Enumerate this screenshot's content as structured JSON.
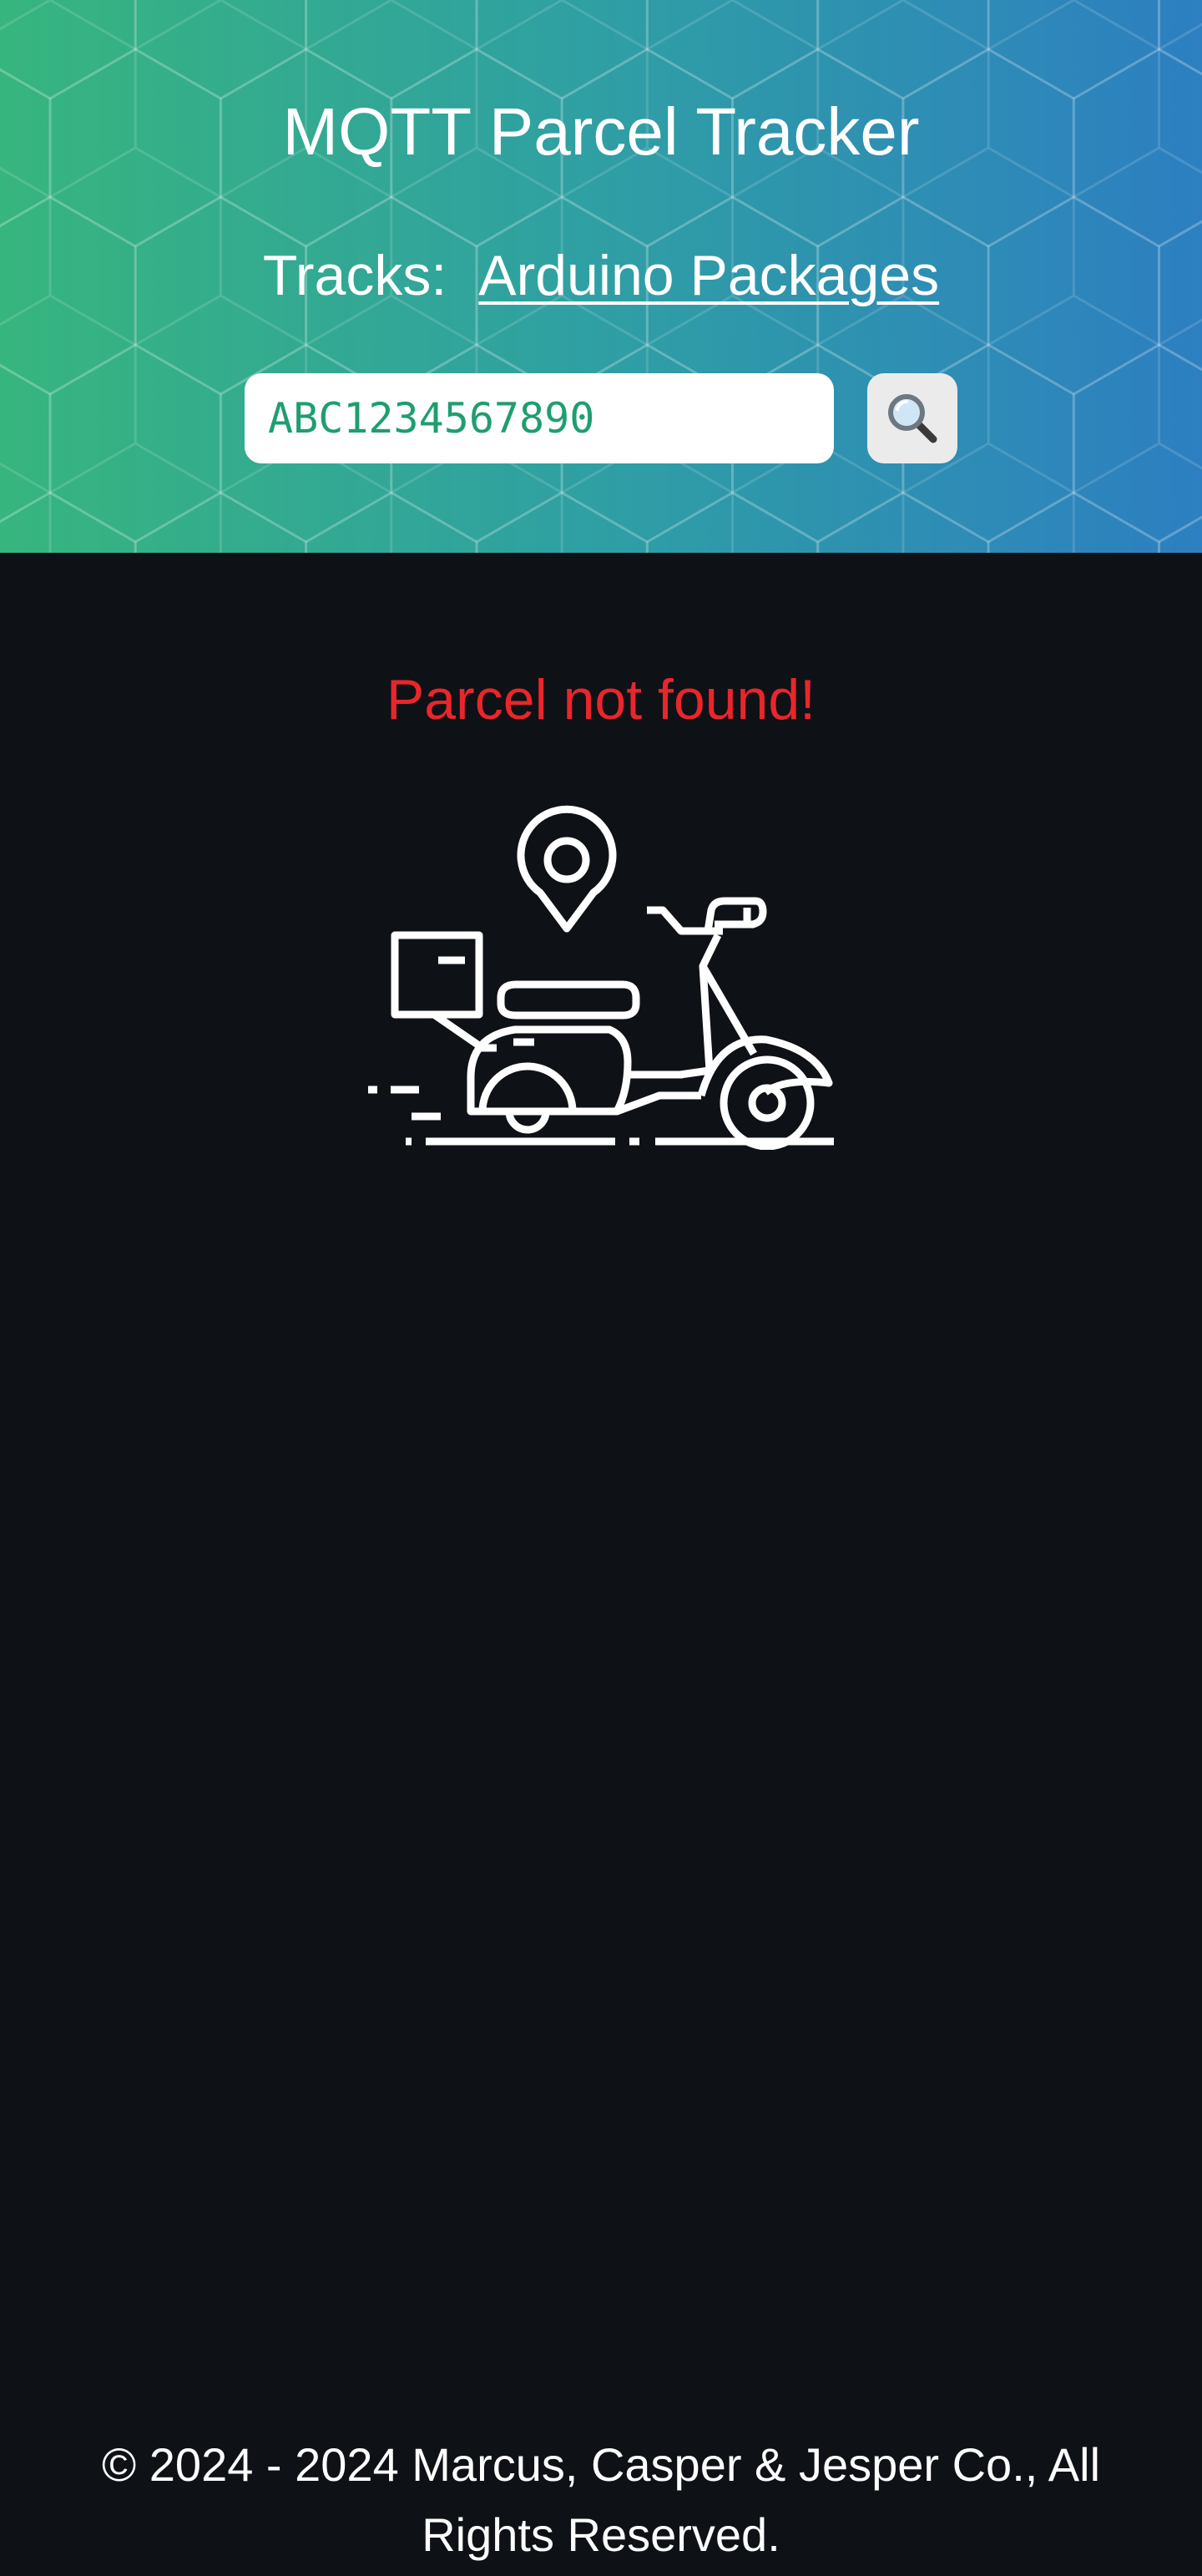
{
  "header": {
    "title": "MQTT Parcel Tracker",
    "tracks_label": "Tracks:",
    "tracks_link": "Arduino Packages",
    "gradient_start": "#37b57e",
    "gradient_end": "#2d7fc1"
  },
  "search": {
    "value": "ABC1234567890",
    "button_icon": "magnifying-glass-icon"
  },
  "result": {
    "status_text": "Parcel not found!",
    "status_color": "#e8262b",
    "illustration": "delivery-scooter-icon"
  },
  "footer": {
    "copyright": "© 2024 - 2024 Marcus, Casper & Jesper Co., All Rights Reserved."
  }
}
